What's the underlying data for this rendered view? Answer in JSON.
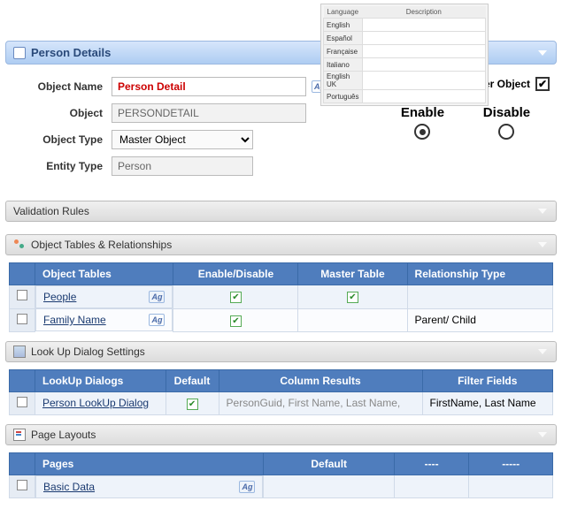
{
  "lang_popup": {
    "headers": [
      "Language",
      "Description"
    ],
    "rows": [
      "English",
      "Español",
      "Française",
      "Italiano",
      "English UK",
      "Português"
    ]
  },
  "panel_title": "Person Details",
  "form": {
    "labels": {
      "object_name": "Object Name",
      "object": "Object",
      "object_type": "Object Type",
      "entity_type": "Entity Type"
    },
    "values": {
      "object_name": "Person Detail",
      "object": "PERSONDETAIL",
      "object_type": "Master Object",
      "entity_type": "Person"
    },
    "master_object_label": "Master Object",
    "master_object_checked": true,
    "enable_label": "Enable",
    "disable_label": "Disable",
    "ag_icon": "Ag"
  },
  "validation_title": "Validation Rules",
  "tables_section": {
    "title": "Object Tables & Relationships",
    "headers": [
      "Object Tables",
      "Enable/Disable",
      "Master Table",
      "Relationship Type"
    ],
    "rows": [
      {
        "name": "People",
        "enable": true,
        "master": true,
        "rel": ""
      },
      {
        "name": "Family Name",
        "enable": true,
        "master": false,
        "rel": "Parent/ Child"
      }
    ]
  },
  "lookup_section": {
    "title": "Look Up Dialog Settings",
    "headers": [
      "LookUp  Dialogs",
      "Default",
      "Column Results",
      "Filter Fields"
    ],
    "rows": [
      {
        "name": "Person LookUp Dialog",
        "default": true,
        "cols": "PersonGuid, First Name, Last Name,",
        "filter": "FirstName, Last Name"
      }
    ]
  },
  "pages_section": {
    "title": "Page Layouts",
    "headers": [
      "Pages",
      "Default",
      "----",
      "-----"
    ],
    "rows": [
      {
        "name": "Basic Data"
      }
    ]
  }
}
